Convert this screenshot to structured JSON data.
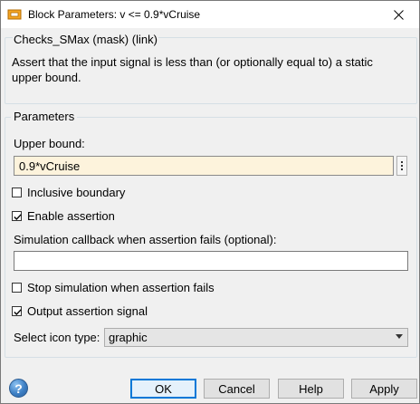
{
  "window": {
    "title": "Block Parameters: v <= 0.9*vCruise"
  },
  "description": {
    "title": "Checks_SMax (mask) (link)",
    "text": "Assert that the input signal is less than (or optionally equal to) a static upper bound."
  },
  "parameters": {
    "group_label": "Parameters",
    "upper_bound_label": "Upper bound:",
    "upper_bound_value": "0.9*vCruise",
    "inclusive_boundary": {
      "label": "Inclusive boundary",
      "checked": false
    },
    "enable_assertion": {
      "label": "Enable assertion",
      "checked": true
    },
    "callback_label": "Simulation callback when assertion fails (optional):",
    "callback_value": "",
    "stop_simulation": {
      "label": "Stop simulation when assertion fails",
      "checked": false
    },
    "output_assertion": {
      "label": "Output assertion signal",
      "checked": true
    },
    "icon_type_label": "Select icon type:",
    "icon_type_value": "graphic"
  },
  "buttons": {
    "ok": "OK",
    "cancel": "Cancel",
    "help": "Help",
    "apply": "Apply"
  },
  "icons": {
    "app": "simulink-block-icon",
    "close": "close-icon",
    "help": "help-icon",
    "menu": "more-options-icon",
    "dropdown": "chevron-down-icon"
  }
}
